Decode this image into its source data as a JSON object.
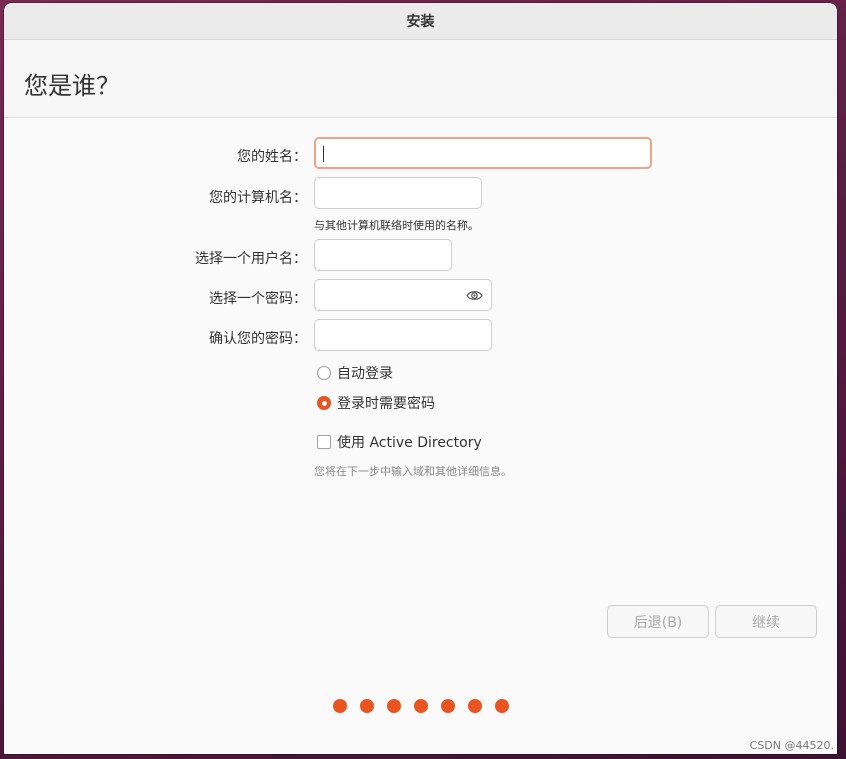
{
  "window": {
    "title": "安装"
  },
  "page": {
    "heading": "您是谁？"
  },
  "form": {
    "name_label": "您的姓名：",
    "name_value": "",
    "computer_label": "您的计算机名：",
    "computer_value": "",
    "computer_hint": "与其他计算机联络时使用的名称。",
    "username_label": "选择一个用户名：",
    "username_value": "",
    "password_label": "选择一个密码：",
    "password_value": "",
    "confirm_label": "确认您的密码：",
    "confirm_value": "",
    "auto_login_label": "自动登录",
    "require_password_label": "登录时需要密码",
    "selected_login_option": "登录时需要密码",
    "active_directory_label": "使用 Active Directory",
    "active_directory_checked": false,
    "active_directory_hint": "您将在下一步中输入域和其他详细信息。"
  },
  "buttons": {
    "back": "后退(B)",
    "continue": "继续"
  },
  "progress": {
    "total_steps": 7
  },
  "icons": {
    "password_toggle": "eye-icon"
  },
  "colors": {
    "accent": "#e95420",
    "focus_border": "#f0a284"
  },
  "watermark": "CSDN @44520."
}
